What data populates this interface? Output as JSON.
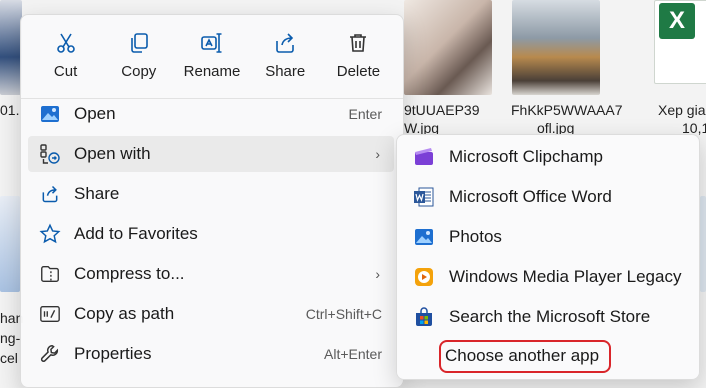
{
  "background": {
    "labels": {
      "left_a": "01.",
      "file1_line1": "9tUUAEP39",
      "file1_line2": "W.jpg",
      "file2_line1": "FhKkP5WWAAA7",
      "file2_line2": "ofl.jpg",
      "file3_line1": "Xep gia",
      "file3_line2": "10,1",
      "left_b": "han",
      "left_c": "ng-",
      "left_d": "cel"
    }
  },
  "quick_actions": [
    {
      "label": "Cut",
      "icon": "scissors-icon"
    },
    {
      "label": "Copy",
      "icon": "copy-icon"
    },
    {
      "label": "Rename",
      "icon": "rename-icon"
    },
    {
      "label": "Share",
      "icon": "share-icon"
    },
    {
      "label": "Delete",
      "icon": "trash-icon"
    }
  ],
  "menu": {
    "items": [
      {
        "label": "Open",
        "shortcut": "Enter",
        "icon": "photo-app-icon"
      },
      {
        "label": "Open with",
        "shortcut": "",
        "icon": "open-with-icon",
        "submenu": true
      },
      {
        "label": "Share",
        "shortcut": "",
        "icon": "share-icon"
      },
      {
        "label": "Add to Favorites",
        "shortcut": "",
        "icon": "star-icon"
      },
      {
        "label": "Compress to...",
        "shortcut": "",
        "icon": "archive-icon",
        "submenu": true
      },
      {
        "label": "Copy as path",
        "shortcut": "Ctrl+Shift+C",
        "icon": "path-icon"
      },
      {
        "label": "Properties",
        "shortcut": "Alt+Enter",
        "icon": "wrench-icon"
      }
    ],
    "chevron": "›"
  },
  "submenu": {
    "items": [
      {
        "label": "Microsoft Clipchamp",
        "icon": "clipchamp-icon"
      },
      {
        "label": "Microsoft Office Word",
        "icon": "word-icon"
      },
      {
        "label": "Photos",
        "icon": "photos-icon"
      },
      {
        "label": "Windows Media Player Legacy",
        "icon": "media-player-icon"
      },
      {
        "label": "Search the Microsoft Store",
        "icon": "store-icon"
      },
      {
        "label": "Choose another app",
        "icon": ""
      }
    ]
  },
  "colors": {
    "accent": "#0067c0",
    "highlight_box": "#d9252a"
  }
}
